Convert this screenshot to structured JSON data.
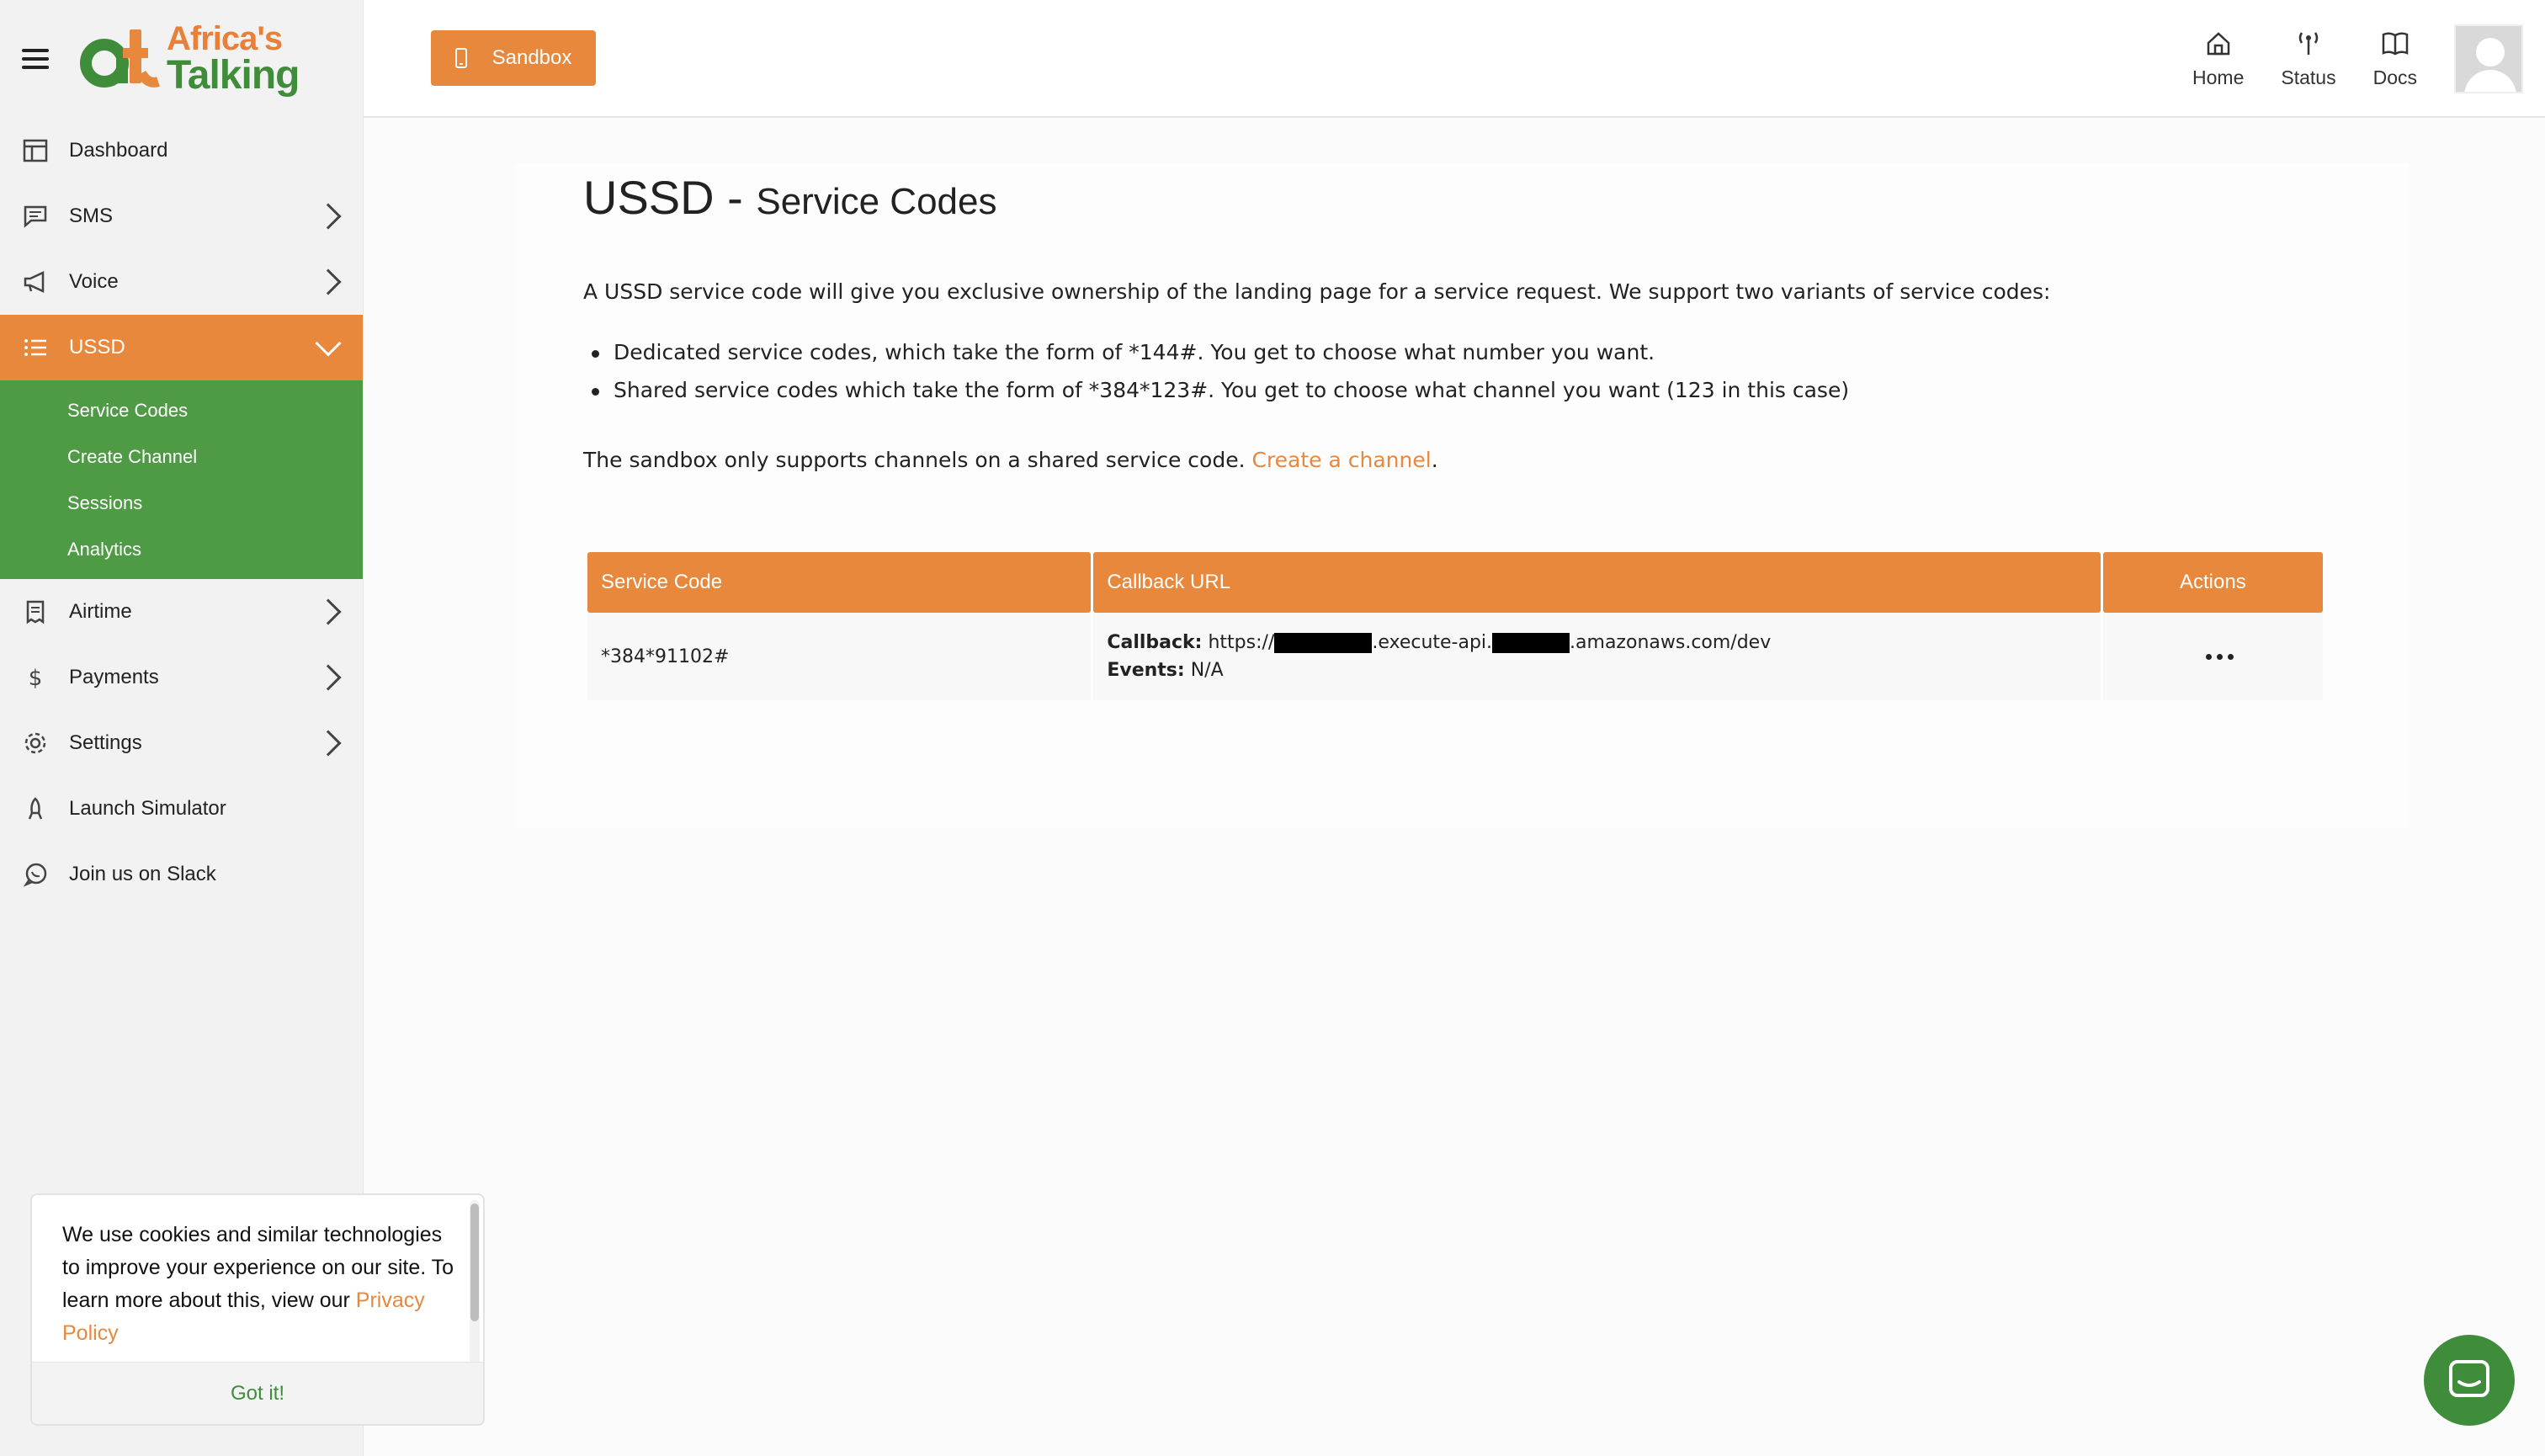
{
  "brand": {
    "line1": "Africa's",
    "line2": "Talking"
  },
  "sidebar": {
    "items": [
      {
        "label": "Dashboard"
      },
      {
        "label": "SMS"
      },
      {
        "label": "Voice"
      },
      {
        "label": "USSD"
      },
      {
        "label": "Airtime"
      },
      {
        "label": "Payments"
      },
      {
        "label": "Settings"
      },
      {
        "label": "Launch Simulator"
      },
      {
        "label": "Join us on Slack"
      }
    ],
    "ussd_sub": [
      "Service Codes",
      "Create Channel",
      "Sessions",
      "Analytics"
    ]
  },
  "topbar": {
    "sandbox_label": "Sandbox",
    "links": {
      "home": "Home",
      "status": "Status",
      "docs": "Docs"
    }
  },
  "page": {
    "title_main": "USSD - ",
    "title_sub": "Service Codes",
    "intro": "A USSD service code will give you exclusive ownership of the landing page for a service request. We support two variants of service codes:",
    "bullets": [
      "Dedicated service codes, which take the form of *144#. You get to choose what number you want.",
      "Shared service codes which take the form of *384*123#. You get to choose what channel you want (123 in this case)"
    ],
    "note_prefix": "The sandbox only supports channels on a shared service code. ",
    "note_link": "Create a channel",
    "note_suffix": "."
  },
  "table": {
    "headers": {
      "code": "Service Code",
      "callback": "Callback URL",
      "actions": "Actions"
    },
    "rows": [
      {
        "code": "*384*91102#",
        "callback_label": "Callback:",
        "callback_p1": "https://",
        "callback_p2": ".execute-api.",
        "callback_p3": ".amazonaws.com/dev",
        "events_label": "Events:",
        "events_value": "N/A"
      }
    ]
  },
  "cookie": {
    "text": "We use cookies and similar technologies to improve your experience on our site. To learn more about this, view our ",
    "link": "Privacy Policy",
    "button": "Got it!"
  },
  "colors": {
    "orange": "#e8883c",
    "green": "#4e9a45",
    "dark_green": "#3f8d3b"
  }
}
